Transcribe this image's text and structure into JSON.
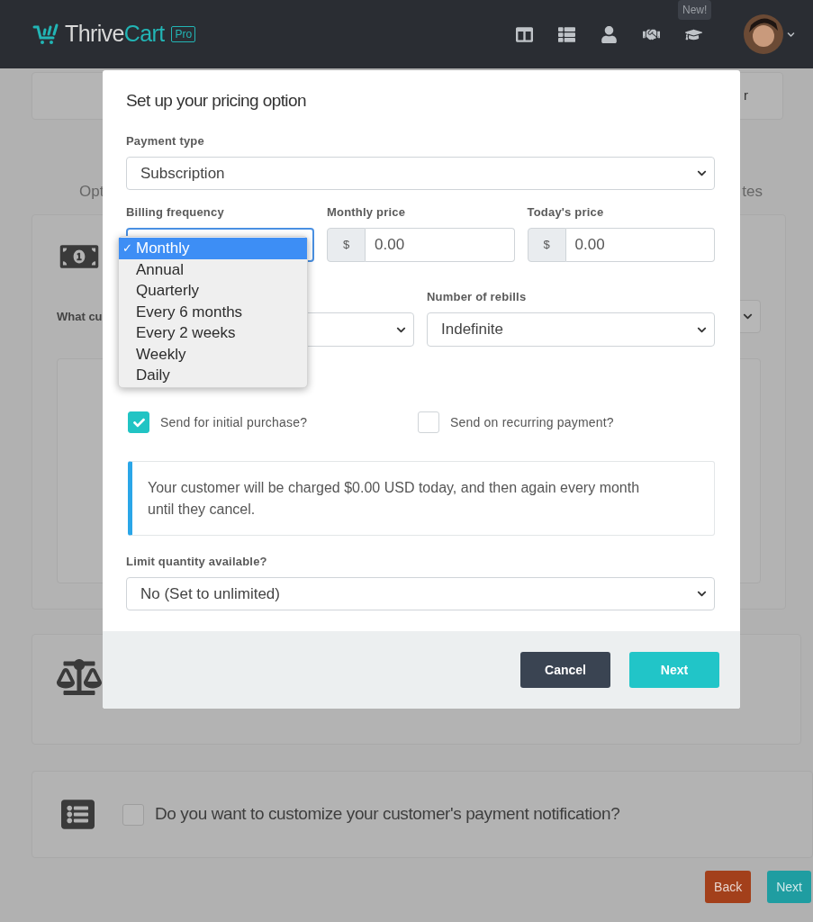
{
  "header": {
    "logo": {
      "prefix": "Thrive",
      "suffix": "Cart",
      "badge": "Pro"
    },
    "nav_icons": [
      {
        "kind": "columns"
      },
      {
        "kind": "list"
      },
      {
        "kind": "user"
      },
      {
        "kind": "handshake"
      },
      {
        "kind": "cap",
        "tooltip": "New!"
      }
    ]
  },
  "background": {
    "tab_fragment": "r",
    "steps": [
      "Opt",
      "tes"
    ],
    "pricing_label": "What cu",
    "notification": {
      "question": "Do you want to customize your customer's payment notification?",
      "checked": false
    },
    "buttons": [
      {
        "label": "Back",
        "kind": "back"
      },
      {
        "label": "Next",
        "kind": "next"
      }
    ]
  },
  "modal": {
    "title": "Set up your pricing option",
    "payment_type": {
      "label": "Payment type",
      "value": "Subscription"
    },
    "billing_frequency": {
      "label": "Billing frequency",
      "selected_mark": "✓",
      "options": [
        {
          "label": "Monthly",
          "selected": true
        },
        {
          "label": "Annual",
          "selected": false
        },
        {
          "label": "Quarterly",
          "selected": false
        },
        {
          "label": "Every 6 months",
          "selected": false
        },
        {
          "label": "Every 2 weeks",
          "selected": false
        },
        {
          "label": "Weekly",
          "selected": false
        },
        {
          "label": "Daily",
          "selected": false
        }
      ]
    },
    "monthly_price": {
      "label": "Monthly price",
      "prefix": "$",
      "value": "0.00"
    },
    "todays_price": {
      "label": "Today's price",
      "prefix": "$",
      "value": "0.00"
    },
    "rebills": {
      "label": "Number of rebills",
      "value": "Indefinite"
    },
    "email": {
      "options": [
        {
          "label": "Send for initial purchase?",
          "checked": true
        },
        {
          "label": "Send on recurring payment?",
          "checked": false
        }
      ]
    },
    "summary": "Your customer will be charged $0.00 USD today, and then again every month until they cancel.",
    "limit": {
      "label": "Limit quantity available?",
      "value": "No (Set to unlimited)"
    },
    "buttons": [
      {
        "label": "Cancel",
        "kind": "cancel"
      },
      {
        "label": "Next",
        "kind": "next"
      }
    ]
  }
}
